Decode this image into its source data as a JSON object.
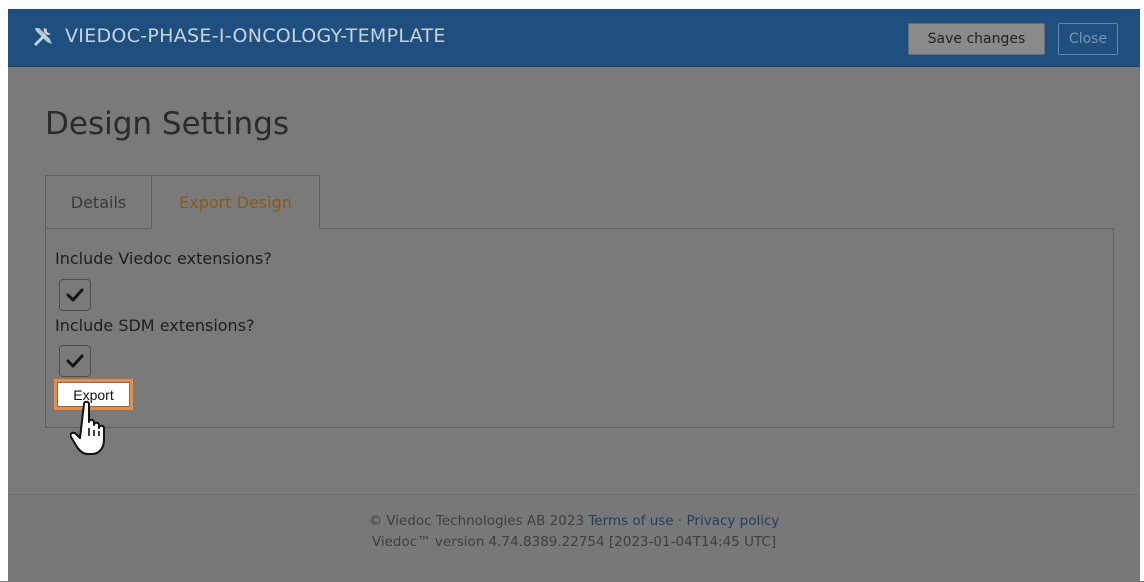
{
  "header": {
    "title": "VIEDOC-PHASE-I-ONCOLOGY-TEMPLATE",
    "icon": "tools-icon",
    "save_label": "Save changes",
    "close_label": "Close"
  },
  "page": {
    "title": "Design Settings"
  },
  "tabs": [
    {
      "label": "Details",
      "active": false
    },
    {
      "label": "Export Design",
      "active": true
    }
  ],
  "form": {
    "viedoc_ext_label": "Include Viedoc extensions?",
    "viedoc_ext_checked": true,
    "sdm_ext_label": "Include SDM extensions?",
    "sdm_ext_checked": true,
    "export_label": "Export"
  },
  "footer": {
    "copyright": "© Viedoc Technologies AB 2023",
    "terms": "Terms of use",
    "separator": "·",
    "privacy": "Privacy policy",
    "version": "Viedoc™ version 4.74.8389.22754 [2023-01-04T14:45 UTC]"
  },
  "colors": {
    "header_bg": "#1f4f7f",
    "overlay": "#7a7a7a",
    "highlight": "#f08a3c",
    "active_tab": "#8a5a16"
  }
}
